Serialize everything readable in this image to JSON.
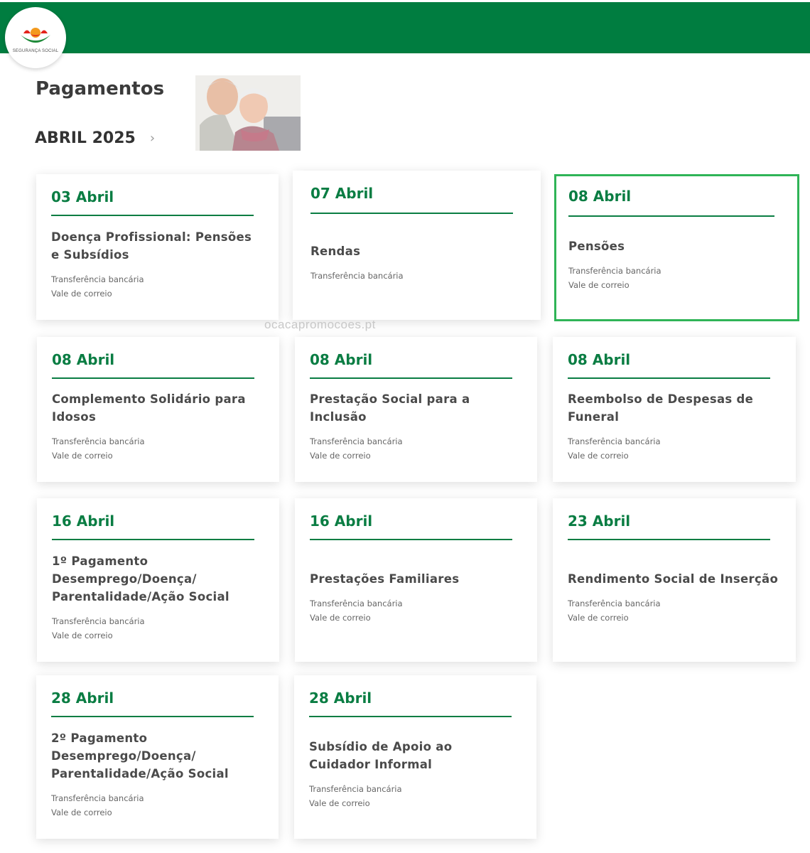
{
  "brand": {
    "logo_text": "SEGURANÇA SOCIAL",
    "primary_color": "#007d40",
    "accent_color": "#0a7d43",
    "highlight_color": "#2fb457"
  },
  "header": {
    "title": "Pagamentos",
    "month": "ABRIL 2025",
    "next_icon": "chevron-right-icon"
  },
  "watermark": "ocacapromocoes.pt",
  "cards": [
    {
      "date": "03 Abril",
      "title": "Doença Profissional: Pensões e Subsídios",
      "methods": [
        "Transferência bancária",
        "Vale de correio"
      ]
    },
    {
      "date": "07 Abril",
      "title": "Rendas",
      "methods": [
        "Transferência bancária"
      ]
    },
    {
      "date": "08 Abril",
      "title": "Pensões",
      "methods": [
        "Transferência bancária",
        "Vale de correio"
      ]
    },
    {
      "date": "08 Abril",
      "title": "Complemento Solidário para Idosos",
      "methods": [
        "Transferência bancária",
        "Vale de correio"
      ]
    },
    {
      "date": "08 Abril",
      "title": "Prestação Social para a Inclusão",
      "methods": [
        "Transferência bancária",
        "Vale de correio"
      ]
    },
    {
      "date": "08 Abril",
      "title": "Reembolso de Despesas de Funeral",
      "methods": [
        "Transferência bancária",
        "Vale de correio"
      ]
    },
    {
      "date": "16 Abril",
      "title": "1º Pagamento Desemprego/Doença/ Parentalidade/Ação Social",
      "methods": [
        "Transferência bancária",
        "Vale de correio"
      ]
    },
    {
      "date": "16 Abril",
      "title": "Prestações Familiares",
      "methods": [
        "Transferência bancária",
        "Vale de correio"
      ]
    },
    {
      "date": "23 Abril",
      "title": "Rendimento Social de Inserção",
      "methods": [
        "Transferência bancária",
        "Vale de correio"
      ]
    },
    {
      "date": "28 Abril",
      "title": "2º Pagamento Desemprego/Doença/ Parentalidade/Ação Social",
      "methods": [
        "Transferência bancária",
        "Vale de correio"
      ]
    },
    {
      "date": "28 Abril",
      "title": "Subsídio de Apoio ao Cuidador Informal",
      "methods": [
        "Transferência bancária",
        "Vale de correio"
      ]
    }
  ]
}
